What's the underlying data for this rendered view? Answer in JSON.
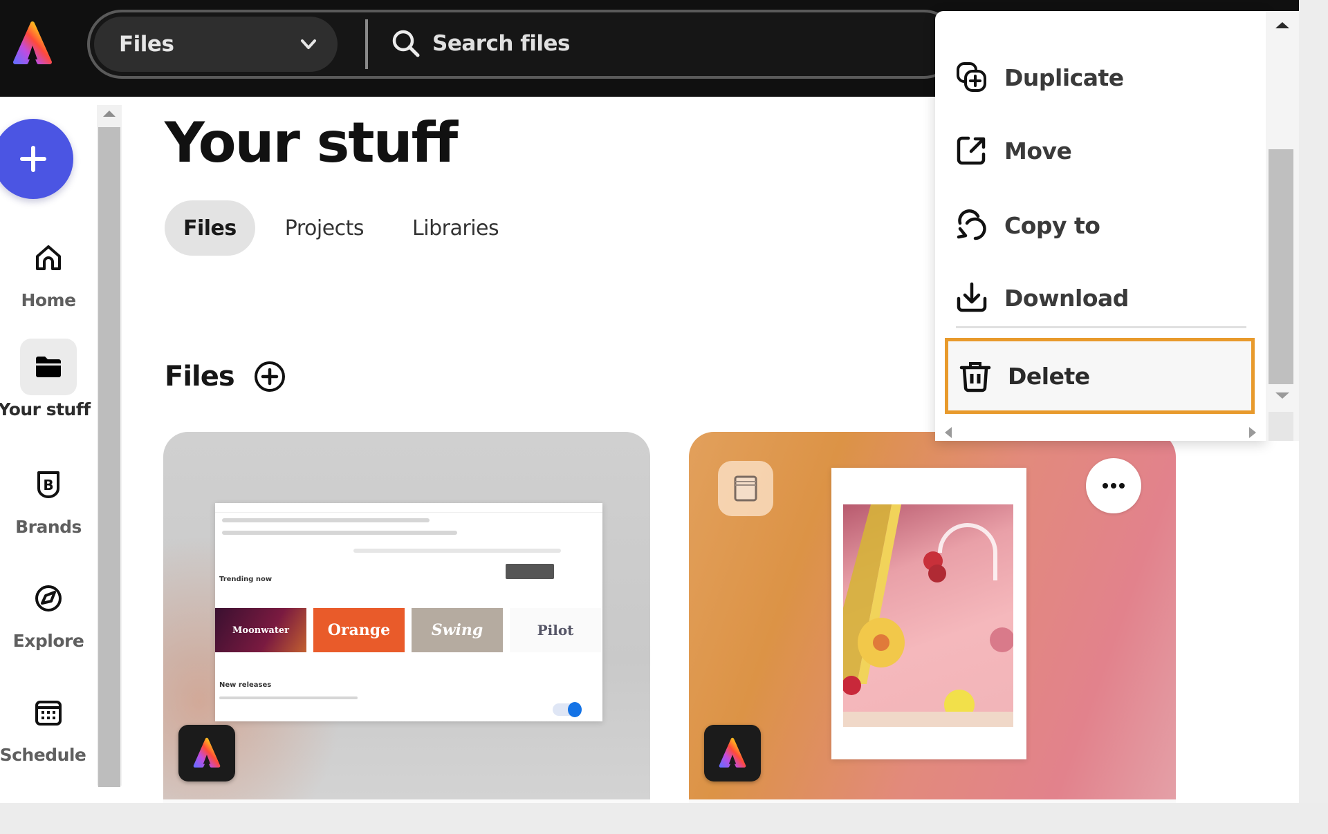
{
  "topbar": {
    "logo": "adobe-express-logo",
    "scope_select": {
      "value": "Files",
      "icon": "chevron-down-icon"
    },
    "search": {
      "placeholder": "Search files",
      "value": "",
      "icon": "search-icon"
    }
  },
  "sidebar": {
    "create_button": {
      "icon": "plus-icon"
    },
    "items": [
      {
        "label": "Home",
        "icon": "home-icon",
        "active": false
      },
      {
        "label": "Your stuff",
        "icon": "folder-icon",
        "active": true
      },
      {
        "label": "Brands",
        "icon": "brand-icon",
        "active": false
      },
      {
        "label": "Explore",
        "icon": "explore-icon",
        "active": false
      },
      {
        "label": "Schedule",
        "icon": "calendar-icon",
        "active": false
      }
    ]
  },
  "main": {
    "title": "Your stuff",
    "tabs": [
      {
        "label": "Files",
        "active": true
      },
      {
        "label": "Projects",
        "active": false
      },
      {
        "label": "Libraries",
        "active": false
      }
    ],
    "section": {
      "title": "Files",
      "add_icon": "add-circle-icon"
    },
    "cards": [
      {
        "kind": "screenshot",
        "thumbnail_tiles": [
          "Moonwater",
          "Orange",
          "Swing",
          "Pilot"
        ],
        "app_badge": "adobe-express-logo"
      },
      {
        "kind": "poster",
        "type_icon": "document-icon",
        "more_icon": "more-icon",
        "app_badge": "adobe-express-logo"
      }
    ]
  },
  "context_menu": {
    "items": [
      {
        "label": "Duplicate",
        "icon": "duplicate-icon"
      },
      {
        "label": "Move",
        "icon": "move-icon"
      },
      {
        "label": "Copy to",
        "icon": "copy-to-icon"
      },
      {
        "label": "Download",
        "icon": "download-icon"
      },
      {
        "label": "Delete",
        "icon": "trash-icon",
        "focused": true
      }
    ],
    "focus_color": "#e89a2c"
  },
  "colors": {
    "topbar_bg": "#101010",
    "accent_create": "#4b55e3",
    "focus_outline": "#e89a2c"
  }
}
